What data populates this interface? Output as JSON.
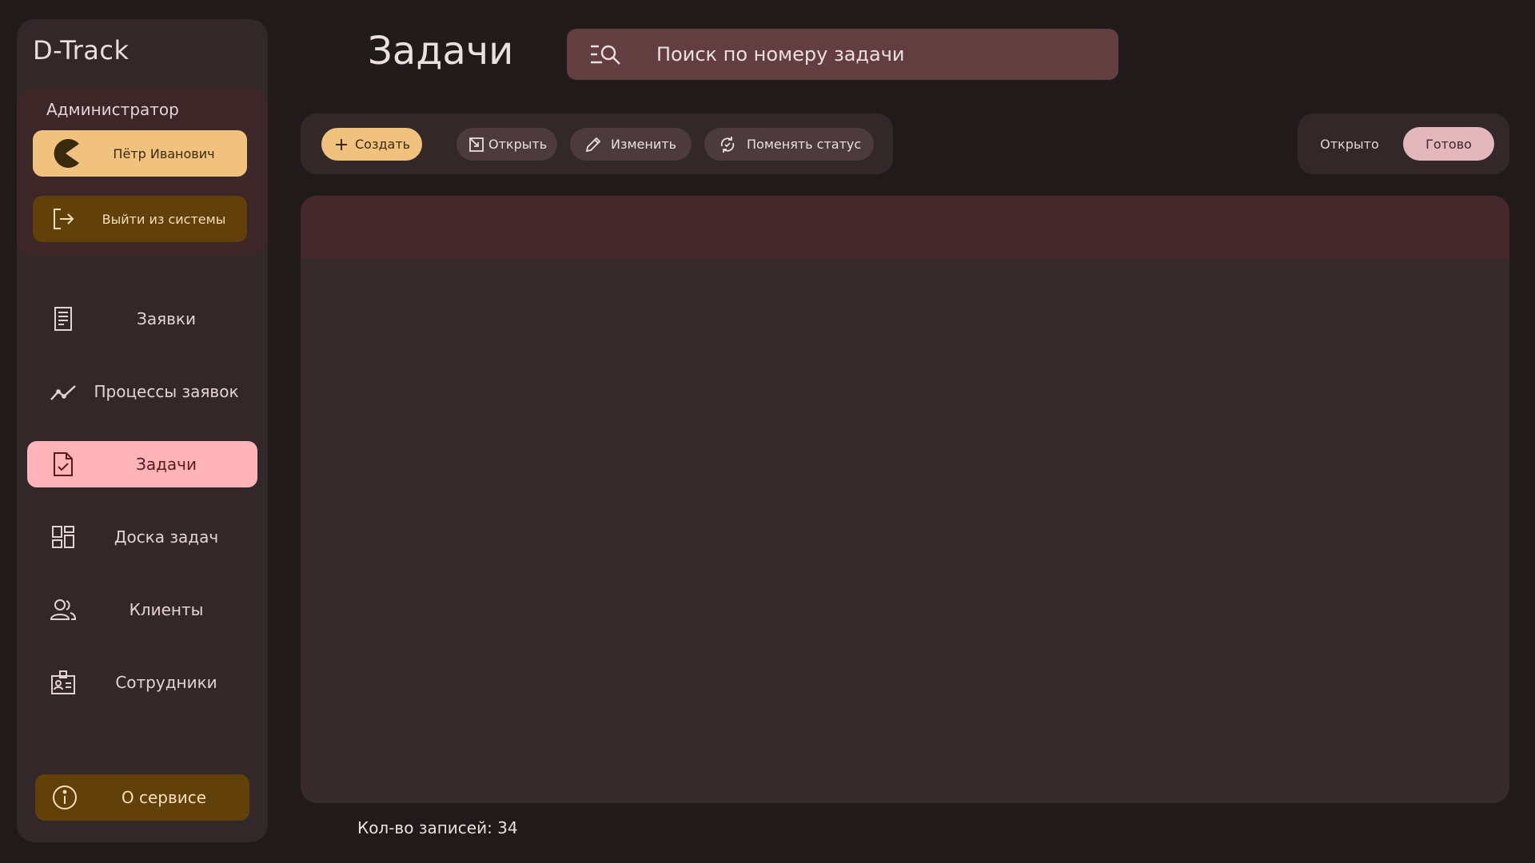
{
  "app": {
    "brand": "D-Track"
  },
  "user": {
    "role": "Администратор",
    "name": "Пётр Иванович",
    "logout_label": "Выйти из системы"
  },
  "nav": {
    "items": [
      {
        "label": "Заявки",
        "icon": "receipt-icon"
      },
      {
        "label": "Процессы заявок",
        "icon": "trending-icon"
      },
      {
        "label": "Задачи",
        "icon": "task-icon",
        "active": true
      },
      {
        "label": "Доска задач",
        "icon": "dashboard-icon"
      },
      {
        "label": "Клиенты",
        "icon": "people-icon"
      },
      {
        "label": "Сотрудники",
        "icon": "badge-icon"
      }
    ],
    "about_label": "О сервисе"
  },
  "page": {
    "title": "Задачи"
  },
  "search": {
    "placeholder": "Поиск по номеру задачи"
  },
  "toolbar": {
    "create_label": "Создать",
    "open_label": "Открыть",
    "edit_label": "Изменить",
    "change_status_label": "Поменять статус"
  },
  "status_filter": {
    "open_label": "Открыто",
    "done_label": "Готово",
    "selected": "Готово"
  },
  "footer": {
    "records_count": "Кол-во записей: 34"
  },
  "colors": {
    "background": "#201a1b",
    "accent_yellow": "#f0c27d",
    "active_pink": "#ffb4b9",
    "brown_button": "#624009"
  }
}
